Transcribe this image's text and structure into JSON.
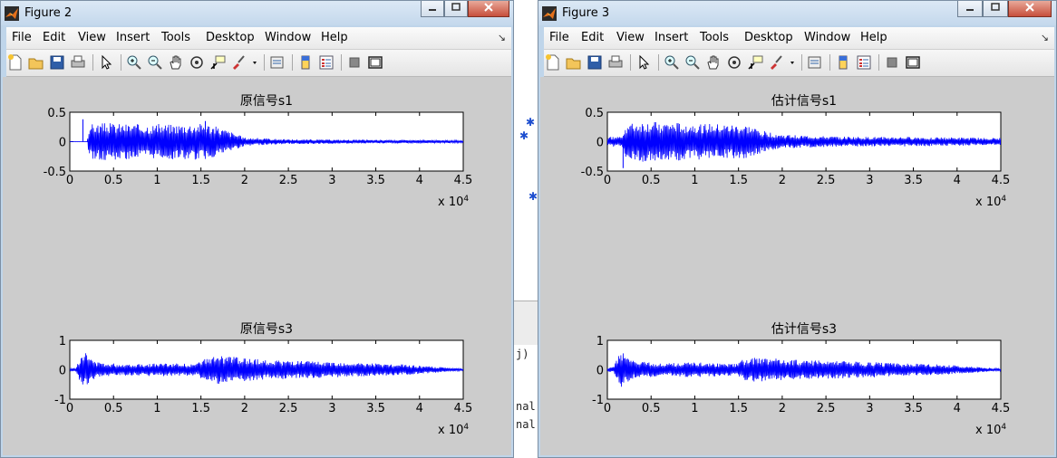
{
  "windows": [
    {
      "id": "figure2",
      "title": "Figure 2",
      "menu": [
        "File",
        "Edit",
        "View",
        "Insert",
        "Tools",
        "Desktop",
        "Window",
        "Help"
      ],
      "plots": [
        {
          "title": "原信号s1",
          "chart_data": {
            "type": "line",
            "title": "原信号s1",
            "xlim": [
              0,
              45000
            ],
            "ylim": [
              -0.5,
              0.5
            ],
            "x_ticks": [
              "0",
              "0.5",
              "1",
              "1.5",
              "2",
              "2.5",
              "3",
              "3.5",
              "4",
              "4.5"
            ],
            "y_ticks": [
              "0.5",
              "0",
              "-0.5"
            ],
            "x_exponent": "x 10",
            "x_exponent_power": "4",
            "series_color": "#0000ff",
            "envelope": {
              "x": [
                0,
                2000,
                2200,
                4000,
                8000,
                12000,
                15500,
                18000,
                20000,
                25000,
                30000,
                35000,
                40000,
                45000
              ],
              "amp": [
                0.003,
                0.003,
                0.3,
                0.32,
                0.3,
                0.3,
                0.32,
                0.2,
                0.07,
                0.04,
                0.035,
                0.03,
                0.028,
                0.02
              ]
            },
            "spikes": [
              [
                1500,
                0.38
              ],
              [
                15500,
                0.35
              ]
            ]
          }
        },
        {
          "title": "原信号s3",
          "chart_data": {
            "type": "line",
            "title": "原信号s3",
            "xlim": [
              0,
              45000
            ],
            "ylim": [
              -1,
              1
            ],
            "x_ticks": [
              "0",
              "0.5",
              "1",
              "1.5",
              "2",
              "2.5",
              "3",
              "3.5",
              "4",
              "4.5"
            ],
            "y_ticks": [
              "1",
              "0",
              "-1"
            ],
            "x_exponent": "x 10",
            "x_exponent_power": "4",
            "series_color": "#0000ff",
            "envelope": {
              "x": [
                0,
                700,
                1000,
                1600,
                3000,
                6000,
                10000,
                14500,
                15500,
                17000,
                22000,
                28000,
                34000,
                38000,
                42000,
                45000
              ],
              "amp": [
                0.05,
                0.06,
                0.35,
                0.65,
                0.25,
                0.2,
                0.22,
                0.2,
                0.38,
                0.48,
                0.35,
                0.28,
                0.22,
                0.18,
                0.1,
                0.03
              ]
            },
            "spikes": []
          }
        }
      ]
    },
    {
      "id": "figure3",
      "title": "Figure 3",
      "menu": [
        "File",
        "Edit",
        "View",
        "Insert",
        "Tools",
        "Desktop",
        "Window",
        "Help"
      ],
      "plots": [
        {
          "title": "估计信号s1",
          "chart_data": {
            "type": "line",
            "title": "估计信号s1",
            "xlim": [
              0,
              45000
            ],
            "ylim": [
              -0.5,
              0.5
            ],
            "x_ticks": [
              "0",
              "0.5",
              "1",
              "1.5",
              "2",
              "2.5",
              "3",
              "3.5",
              "4",
              "4.5"
            ],
            "y_ticks": [
              "0.5",
              "0",
              "-0.5"
            ],
            "x_exponent": "x 10",
            "x_exponent_power": "4",
            "series_color": "#0000ff",
            "envelope": {
              "x": [
                0,
                1500,
                2200,
                4000,
                8000,
                12000,
                16000,
                18000,
                20000,
                25000,
                30000,
                35000,
                40000,
                45000
              ],
              "amp": [
                0.08,
                0.09,
                0.3,
                0.34,
                0.32,
                0.3,
                0.28,
                0.18,
                0.12,
                0.09,
                0.08,
                0.08,
                0.07,
                0.06
              ]
            },
            "spikes": [
              [
                1800,
                -0.45
              ]
            ]
          }
        },
        {
          "title": "估计信号s3",
          "chart_data": {
            "type": "line",
            "title": "估计信号s3",
            "xlim": [
              0,
              45000
            ],
            "ylim": [
              -1,
              1
            ],
            "x_ticks": [
              "0",
              "0.5",
              "1",
              "1.5",
              "2",
              "2.5",
              "3",
              "3.5",
              "4",
              "4.5"
            ],
            "y_ticks": [
              "1",
              "0",
              "-1"
            ],
            "x_exponent": "x 10",
            "x_exponent_power": "4",
            "series_color": "#0000ff",
            "envelope": {
              "x": [
                0,
                700,
                1000,
                1600,
                3000,
                6000,
                10000,
                14500,
                15500,
                17000,
                22000,
                28000,
                34000,
                38000,
                42000,
                45000
              ],
              "amp": [
                0.08,
                0.1,
                0.4,
                0.6,
                0.3,
                0.22,
                0.25,
                0.2,
                0.35,
                0.42,
                0.33,
                0.28,
                0.22,
                0.18,
                0.1,
                0.04
              ]
            },
            "spikes": []
          }
        }
      ]
    }
  ],
  "background_text": {
    "code_lines": [
      "j)",
      "nal",
      "nal"
    ]
  },
  "colors": {
    "signal": "#0000ff",
    "figure_bg": "#cccccc",
    "axes_bg": "#ffffff",
    "window_frame": "#bfd5ea"
  }
}
